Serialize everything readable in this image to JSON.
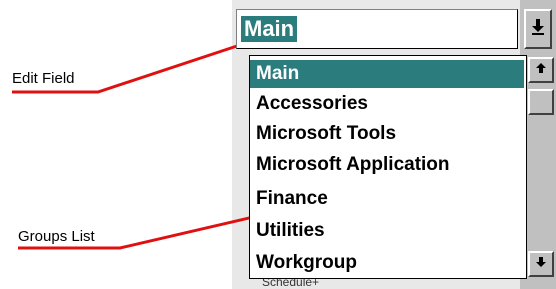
{
  "annotations": {
    "edit_field_label": "Edit Field",
    "groups_list_label": "Groups List"
  },
  "combo": {
    "value": "Main"
  },
  "groups_list": {
    "items": [
      "Main",
      "Accessories",
      "Microsoft Tools",
      "Microsoft Application",
      "Finance",
      "Utilities",
      "Workgroup"
    ],
    "selected_index": 0
  },
  "underlying": {
    "partial_text": "Schedule+"
  },
  "colors": {
    "selection": "#2b7d7d",
    "callout_line": "#e01010",
    "chrome": "#c0c0c0"
  },
  "icons": {
    "dropdown": "down-arrow-underline-icon",
    "scroll_up": "up-arrow-icon",
    "scroll_down": "down-arrow-icon"
  }
}
